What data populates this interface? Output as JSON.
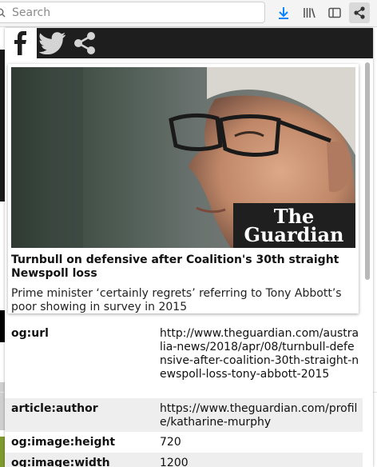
{
  "toolbar": {
    "search_placeholder": "Search",
    "icons": [
      "search-icon",
      "download-icon",
      "library-icon",
      "sidebar-icon",
      "share-icon"
    ]
  },
  "share_panel": {
    "tabs": [
      {
        "name": "facebook",
        "icon": "facebook-icon",
        "active": true
      },
      {
        "name": "twitter",
        "icon": "twitter-icon",
        "active": false
      },
      {
        "name": "share",
        "icon": "share-icon",
        "active": false
      }
    ],
    "preview": {
      "logo_text_line1": "The",
      "logo_text_line2": "Guardian",
      "title": "Turnbull on defensive after Coalition's 30th straight Newspoll loss",
      "description": "Prime minister ‘certainly regrets’ referring to Tony Abbott’s poor showing in survey in 2015"
    },
    "meta": [
      {
        "key": "og:url",
        "value": "http://www.theguardian.com/australia-news/2018/apr/08/turnbull-defensive-after-coalition-30th-straight-newspoll-loss-tony-abbott-2015"
      },
      {
        "key": "article:author",
        "value": "https://www.theguardian.com/profile/katharine-murphy"
      },
      {
        "key": "og:image:height",
        "value": "720"
      },
      {
        "key": "og:image:width",
        "value": "1200"
      }
    ]
  },
  "colors": {
    "share_bar": "#1e1e1e",
    "accent_blue": "#0a84ff",
    "guardian_box": "#1f1f1f"
  }
}
